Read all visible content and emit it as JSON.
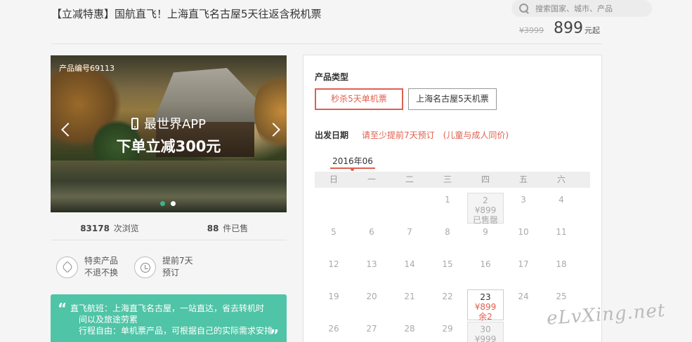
{
  "header": {
    "title": "【立减特惠】国航直飞！上海直飞名古屋5天往返含税机票",
    "search_placeholder": "搜索国家、城市、产品",
    "original_price": "¥3999",
    "price": "899",
    "price_unit": "元起"
  },
  "banner": {
    "product_code": "产品编号69113",
    "promo_line1": "最世界APP",
    "promo_line2": "下单立减300元",
    "slide_count": 2,
    "active_slide": 1
  },
  "stats": {
    "views_count": "83178",
    "views_label": "次浏览",
    "sold_count": "88",
    "sold_label": "件已售"
  },
  "features": [
    {
      "line1": "特卖产品",
      "line2": "不退不换",
      "icon": "tag-icon"
    },
    {
      "line1": "提前7天",
      "line2": "预订",
      "icon": "clock-icon"
    }
  ],
  "description": {
    "line1": "直飞航班：上海直飞名古屋，一站直达，省去转机时",
    "line2": "间以及旅途劳累",
    "line3": "行程自由：单机票产品，可根据自己的实际需求安排"
  },
  "booking": {
    "product_type_label": "产品类型",
    "options": [
      "秒杀5天单机票",
      "上海名古屋5天机票"
    ],
    "selected_option": 0,
    "date_label": "出发日期",
    "date_note": "请至少提前7天预订　(儿童与成人同价)",
    "month": "2016年06",
    "weekdays": [
      "日",
      "一",
      "二",
      "三",
      "四",
      "五",
      "六"
    ],
    "calendar": [
      [
        null,
        null,
        null,
        {
          "day": "1"
        },
        {
          "day": "2",
          "price": "¥899",
          "status": "已售罄",
          "state": "soldout"
        },
        {
          "day": "3"
        },
        {
          "day": "4"
        }
      ],
      [
        {
          "day": "5"
        },
        {
          "day": "6"
        },
        {
          "day": "7"
        },
        {
          "day": "8"
        },
        {
          "day": "9"
        },
        {
          "day": "10"
        },
        {
          "day": "11"
        }
      ],
      [
        {
          "day": "12"
        },
        {
          "day": "13"
        },
        {
          "day": "14"
        },
        {
          "day": "15"
        },
        {
          "day": "16"
        },
        {
          "day": "17"
        },
        {
          "day": "18"
        }
      ],
      [
        {
          "day": "19"
        },
        {
          "day": "20"
        },
        {
          "day": "21"
        },
        {
          "day": "22"
        },
        {
          "day": "23",
          "price": "¥899",
          "status": "余2",
          "state": "available"
        },
        {
          "day": "24"
        },
        {
          "day": "25"
        }
      ],
      [
        {
          "day": "26"
        },
        {
          "day": "27"
        },
        {
          "day": "28"
        },
        {
          "day": "29"
        },
        {
          "day": "30",
          "price": "¥999",
          "state": "soldout"
        },
        null,
        null
      ]
    ]
  },
  "watermark": "eLvXing.net"
}
